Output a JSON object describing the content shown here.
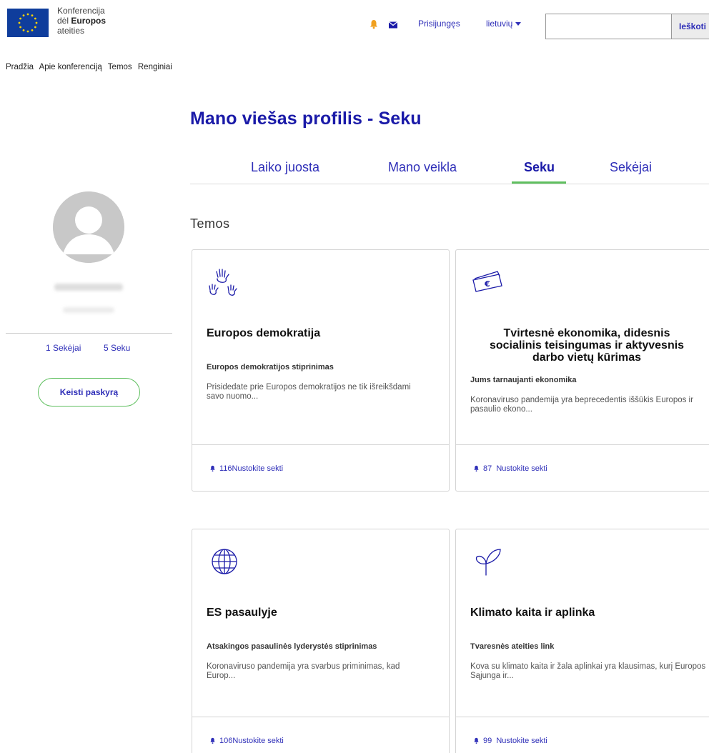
{
  "header": {
    "logo_line1": "Konferencija",
    "logo_line2_prefix": "dėl ",
    "logo_line2_bold": "Europos",
    "logo_line3": "ateities",
    "login": "Prisijungęs",
    "language": "lietuvių",
    "search_placeholder": "",
    "search_button": "Ieškoti"
  },
  "nav": [
    "Pradžia",
    "Apie konferenciją",
    "Temos",
    "Renginiai"
  ],
  "page": {
    "title": "Mano viešas profilis - Seku",
    "tabs": [
      {
        "label": "Laiko juosta",
        "active": false
      },
      {
        "label": "Mano veikla",
        "active": false
      },
      {
        "label": "Seku",
        "active": true
      },
      {
        "label": "Sekėjai",
        "active": false
      }
    ]
  },
  "profile": {
    "followers": "1 Sekėjai",
    "following": "5 Seku",
    "edit_button": "Keisti paskyrą"
  },
  "section": {
    "title": "Temos"
  },
  "cards": [
    {
      "icon": "hands-icon",
      "title": "Europos demokratija",
      "subtitle": "Europos demokratijos stiprinimas",
      "description": "Prisidedate prie Europos demokratijos ne tik išreikšdami savo nuomo...",
      "footer": "116Nustokite sekti"
    },
    {
      "icon": "euro-bill-icon",
      "title": "Tvirtesnė ekonomika, didesnis socialinis teisingumas ir aktyvesnis darbo vietų kūrimas",
      "subtitle": "Jums tarnaujanti ekonomika",
      "description": "Koronaviruso pandemija yra beprecedentis iššūkis Europos ir pasaulio ekono...",
      "footer": "87  Nustokite sekti"
    },
    {
      "icon": "globe-icon",
      "title": "ES pasaulyje",
      "subtitle": "Atsakingos pasaulinės lyderystės stiprinimas",
      "description": "Koronaviruso pandemija yra svarbus priminimas, kad Europ...",
      "footer": "106Nustokite sekti"
    },
    {
      "icon": "sprout-icon",
      "title": "Klimato kaita ir aplinka",
      "subtitle": "Tvaresnės ateities link",
      "description": "Kova su klimato kaita ir žala aplinkai yra klausimas, kurį Europos Sąjunga ir...",
      "footer": "99  Nustokite sekti"
    }
  ],
  "colors": {
    "primary": "#1a1aa8",
    "link": "#2f2fb8",
    "accent_green": "#5fbf5f",
    "bell_orange": "#f0a020",
    "eu_blue": "#0f3d9c"
  }
}
